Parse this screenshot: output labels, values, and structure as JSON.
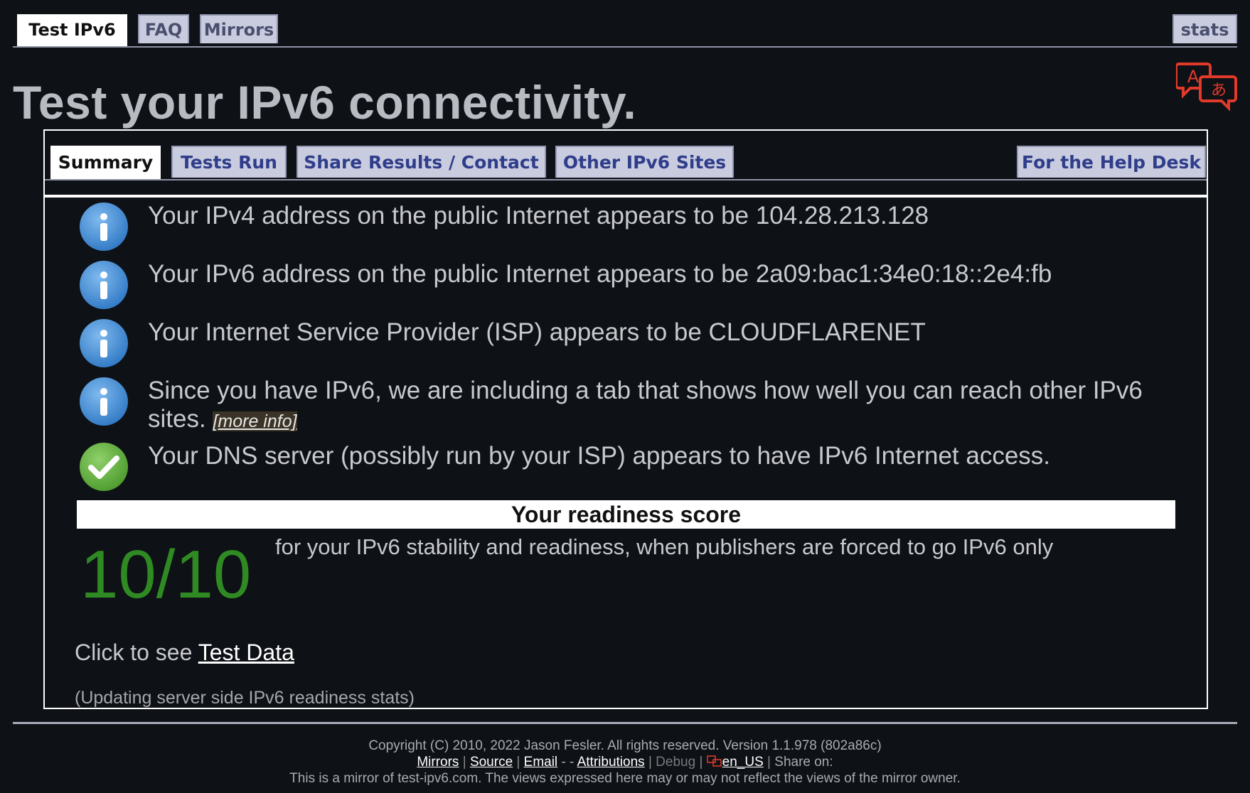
{
  "top_tabs": [
    {
      "label": "Test IPv6"
    },
    {
      "label": "FAQ"
    },
    {
      "label": "Mirrors"
    }
  ],
  "stats_tab": "stats",
  "title": "Test your IPv6 connectivity.",
  "sub_tabs": [
    {
      "label": "Summary"
    },
    {
      "label": "Tests Run"
    },
    {
      "label": "Share Results / Contact"
    },
    {
      "label": "Other IPv6 Sites"
    }
  ],
  "help_desk_tab": "For the Help Desk",
  "results": [
    {
      "icon": "info-icon",
      "text": "Your IPv4 address on the public Internet appears to be 104.28.213.128"
    },
    {
      "icon": "info-icon",
      "text": "Your IPv6 address on the public Internet appears to be 2a09:bac1:34e0:18::2e4:fb"
    },
    {
      "icon": "info-icon",
      "text": "Your Internet Service Provider (ISP) appears to be CLOUDFLARENET"
    },
    {
      "icon": "info-icon",
      "text": "Since you have IPv6, we are including a tab that shows how well you can reach other IPv6 sites.",
      "link": "[more info]"
    },
    {
      "icon": "check-icon",
      "text": "Your DNS server (possibly run by your ISP) appears to have IPv6 Internet access."
    }
  ],
  "readiness": {
    "heading": "Your readiness score",
    "score": "10/10",
    "description": "for your IPv6 stability and readiness, when publishers are forced to go IPv6 only"
  },
  "test_data": {
    "prefix": "Click to see",
    "link": "Test Data"
  },
  "updating_text": "(Updating server side IPv6 readiness stats)",
  "footer": {
    "copyright": "Copyright (C) 2010, 2022 Jason Fesler. All rights reserved. Version 1.1.978 (802a86c)",
    "links": {
      "mirrors": "Mirrors",
      "source": "Source",
      "email": "Email",
      "dashes": "-   -",
      "attributions": "Attributions",
      "debug": "Debug",
      "locale": "en_US",
      "share": "Share on:"
    },
    "mirror_note": "This is a mirror of test-ipv6.com. The views expressed here may or may not reflect the views of the mirror owner."
  },
  "colors": {
    "background": "#0e1116",
    "tab": "#c9ccdf",
    "score": "#2f8a23",
    "info_icon": "#3b86d1",
    "check_icon": "#5aa83a",
    "translate_icon": "#e23a2a"
  }
}
